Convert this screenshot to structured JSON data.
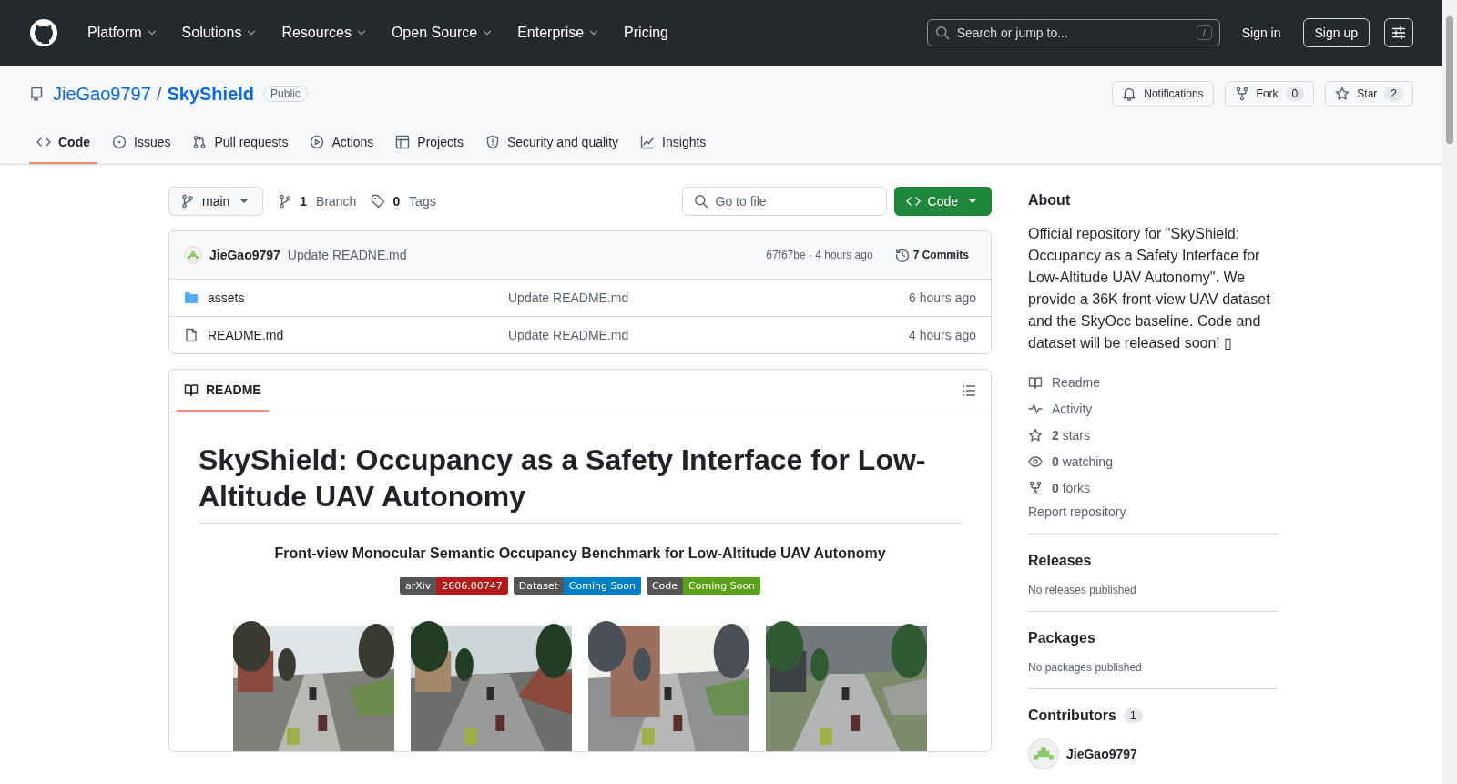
{
  "header": {
    "nav": [
      {
        "label": "Platform",
        "dropdown": true
      },
      {
        "label": "Solutions",
        "dropdown": true
      },
      {
        "label": "Resources",
        "dropdown": true
      },
      {
        "label": "Open Source",
        "dropdown": true
      },
      {
        "label": "Enterprise",
        "dropdown": true
      },
      {
        "label": "Pricing",
        "dropdown": false
      }
    ],
    "search_placeholder": "Search or jump to...",
    "search_key": "/",
    "sign_in": "Sign in",
    "sign_up": "Sign up"
  },
  "repo": {
    "owner": "JieGao9797",
    "separator": "/",
    "name": "SkyShield",
    "visibility": "Public",
    "actions": [
      {
        "kind": "bell",
        "label": "Notifications"
      },
      {
        "kind": "fork",
        "label": "Fork",
        "count": "0"
      },
      {
        "kind": "star",
        "label": "Star",
        "count": "2"
      }
    ]
  },
  "tabs": [
    {
      "label": "Code",
      "selected": true
    },
    {
      "label": "Issues",
      "selected": false
    },
    {
      "label": "Pull requests",
      "selected": false
    },
    {
      "label": "Actions",
      "selected": false
    },
    {
      "label": "Projects",
      "selected": false
    },
    {
      "label": "Security and quality",
      "selected": false
    },
    {
      "label": "Insights",
      "selected": false
    }
  ],
  "toolbar": {
    "branch": "main",
    "branch_count": "1",
    "branch_label": "Branch",
    "tag_count": "0",
    "tag_label": "Tags",
    "go_to_file": "Go to file",
    "code_button": "Code"
  },
  "commit": {
    "author": "JieGao9797",
    "message": "Update READNE.md",
    "hash_time": "67f67be · 4 hours ago",
    "commits": "7 Commits"
  },
  "files": [
    {
      "kind": "folder",
      "name": "assets",
      "message": "Update README.md",
      "time": "6 hours ago"
    },
    {
      "kind": "file",
      "name": "README.md",
      "message": "Update README.md",
      "time": "4 hours ago"
    }
  ],
  "readme": {
    "tab": "README",
    "title": "SkyShield: Occupancy as a Safety Interface for Low-Altitude UAV Autonomy",
    "subtitle": "Front-view Monocular Semantic Occupancy Benchmark for Low-Altitude UAV Autonomy",
    "badges": [
      {
        "label": "arXiv",
        "value": "2606.00747",
        "color": "#b31b1b"
      },
      {
        "label": "Dataset",
        "value": "Coming Soon",
        "color": "#007ec6"
      },
      {
        "label": "Code",
        "value": "Coming Soon",
        "color": "#5ba01b"
      }
    ]
  },
  "sidebar": {
    "about_heading": "About",
    "description": "Official repository for \"SkyShield: Occupancy as a Safety Interface for Low-Altitude UAV Autonomy\". We provide a 36K front-view UAV dataset and the SkyOcc baseline. Code and dataset will be released soon! ▯",
    "links": [
      {
        "text": "Readme"
      },
      {
        "text": "Activity"
      },
      {
        "text": "**2** stars"
      },
      {
        "text": "**0** watching"
      },
      {
        "text": "**0** forks"
      }
    ],
    "report": "Report repository",
    "sections": [
      {
        "heading": "Releases",
        "note": "No releases published"
      },
      {
        "heading": "Packages",
        "note": "No packages published"
      }
    ],
    "contributors_heading": "Contributors",
    "contributors_count": "1",
    "contributor": "JieGao9797"
  }
}
